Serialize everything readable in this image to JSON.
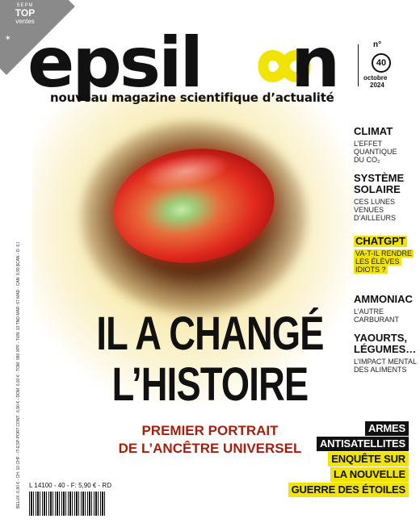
{
  "badge": {
    "small": "SEPM",
    "top": "TOP",
    "ventes": "ventes"
  },
  "masthead": {
    "logo_start": "epsil",
    "logo_end": "n",
    "tagline": "nouveau magazine scientifique d’actualité",
    "issue_label": "n°",
    "issue_number": "40",
    "issue_month": "octobre",
    "issue_year": "2024"
  },
  "teasers": [
    {
      "title": "CLIMAT",
      "lines": [
        "L’EFFET",
        "QUANTIQUE",
        "DU CO₂"
      ],
      "highlight": false
    },
    {
      "title": "SYSTÈME",
      "title2": "SOLAIRE",
      "lines": [
        "CES LUNES",
        "VENUES",
        "D’AILLEURS"
      ],
      "highlight": false
    },
    {
      "title": "CHATGPT",
      "lines": [
        "VA-T-IL RENDRE",
        "LES ÉLÈVES",
        "IDIOTS ?"
      ],
      "highlight": true
    },
    {
      "title": "AMMONIAC",
      "lines": [
        "L’AUTRE",
        "CARBURANT"
      ],
      "highlight": false
    },
    {
      "title": "YAOURTS,",
      "title2": "LÉGUMES…",
      "lines": [
        "L’IMPACT MENTAL",
        "DES ALIMENTS"
      ],
      "highlight": false
    }
  ],
  "headline": {
    "line1": "IL A CHANGÉ",
    "line2": "L’HISTOIRE"
  },
  "subhead": {
    "line1": "PREMIER PORTRAIT",
    "line2": "DE L’ANCÊTRE UNIVERSEL"
  },
  "bottom_right": [
    "ARMES",
    "ANTISATELLITES",
    "ENQUÊTE SUR",
    "LA NOUVELLE",
    "GUERRE DES ÉTOILES"
  ],
  "spine_text": "BELUX: 6,90 € - CH: 10 CHF - IT-ESP-PORT.CONT.: 6,90 € - DOM: 6,90 € - TOM: 980 XPF - TUN: 13 TND MAR: 67 MAD - CAN: 9,99 $CAN - D: 6,90 € CPPAP",
  "barcode_label": "L 14100 - 40 - F: 5,90 € - RD",
  "colors": {
    "accent_yellow": "#f1e400",
    "subhead_red": "#a3200f",
    "badge_gray": "#8a8a8a"
  }
}
